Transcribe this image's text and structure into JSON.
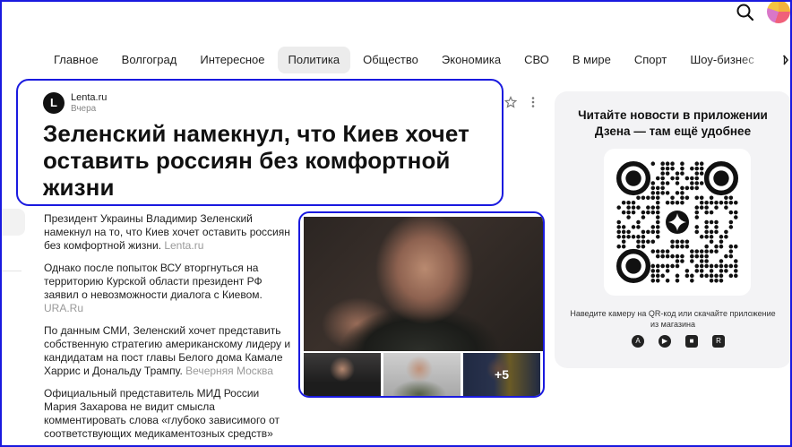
{
  "nav": {
    "items": [
      {
        "label": "Главное",
        "active": false
      },
      {
        "label": "Волгоград",
        "active": false
      },
      {
        "label": "Интересное",
        "active": false
      },
      {
        "label": "Политика",
        "active": true
      },
      {
        "label": "Общество",
        "active": false
      },
      {
        "label": "Экономика",
        "active": false
      },
      {
        "label": "СВО",
        "active": false
      },
      {
        "label": "В мире",
        "active": false
      },
      {
        "label": "Спорт",
        "active": false
      },
      {
        "label": "Шоу-бизнес",
        "active": false
      },
      {
        "label": "П",
        "active": false
      }
    ]
  },
  "article": {
    "source_initial": "L",
    "source_name": "Lenta.ru",
    "time": "Вчера",
    "headline": "Зеленский намекнул, что Киев хочет оставить россиян без комфортной жизни",
    "paragraphs": [
      {
        "text": "Президент Украины Владимир Зеленский намекнул на то, что Киев хочет оставить россиян без комфортной жизни.",
        "source": "Lenta.ru"
      },
      {
        "text": "Однако после попыток ВСУ вторгнуться на территорию Курской области президент РФ заявил о невозможности диалога с Киевом.",
        "source": "URA.Ru"
      },
      {
        "text": "По данным СМИ, Зеленский хочет представить собственную стратегию американскому лидеру и кандидатам на пост главы Белого дома Камале Харрис и Дональду Трампу.",
        "source": "Вечерняя Москва"
      },
      {
        "text": "Официальный представитель МИД России Мария Захарова не видит смысла комментировать слова «глубоко зависимого от соответствующих медикаментозных средств»",
        "source": ""
      }
    ]
  },
  "gallery": {
    "more_count": "+5"
  },
  "promo": {
    "title": "Читайте новости в приложении Дзена — там ещё удобнее",
    "caption": "Наведите камеру на QR-код или скачайте приложение из магазина"
  }
}
